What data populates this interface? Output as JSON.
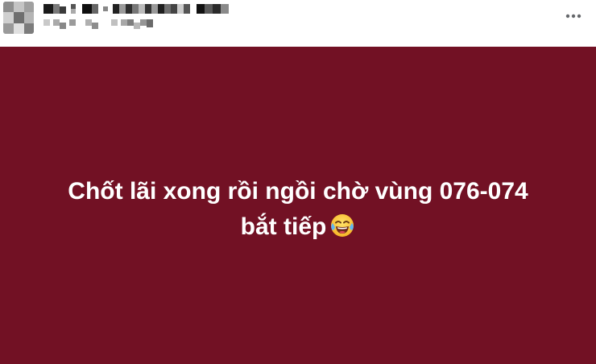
{
  "header": {
    "avatar_icon": "avatar-icon",
    "more_icon": "more-options-icon",
    "author_name": "",
    "post_meta": ""
  },
  "post": {
    "background_color": "#721124",
    "text_color": "#ffffff",
    "text_line_1": "Chốt lãi xong rồi ngồi chờ vùng 076-074",
    "text_line_2": "bắt tiếp",
    "emoji_icon": "face-with-tears-of-joy-icon"
  }
}
